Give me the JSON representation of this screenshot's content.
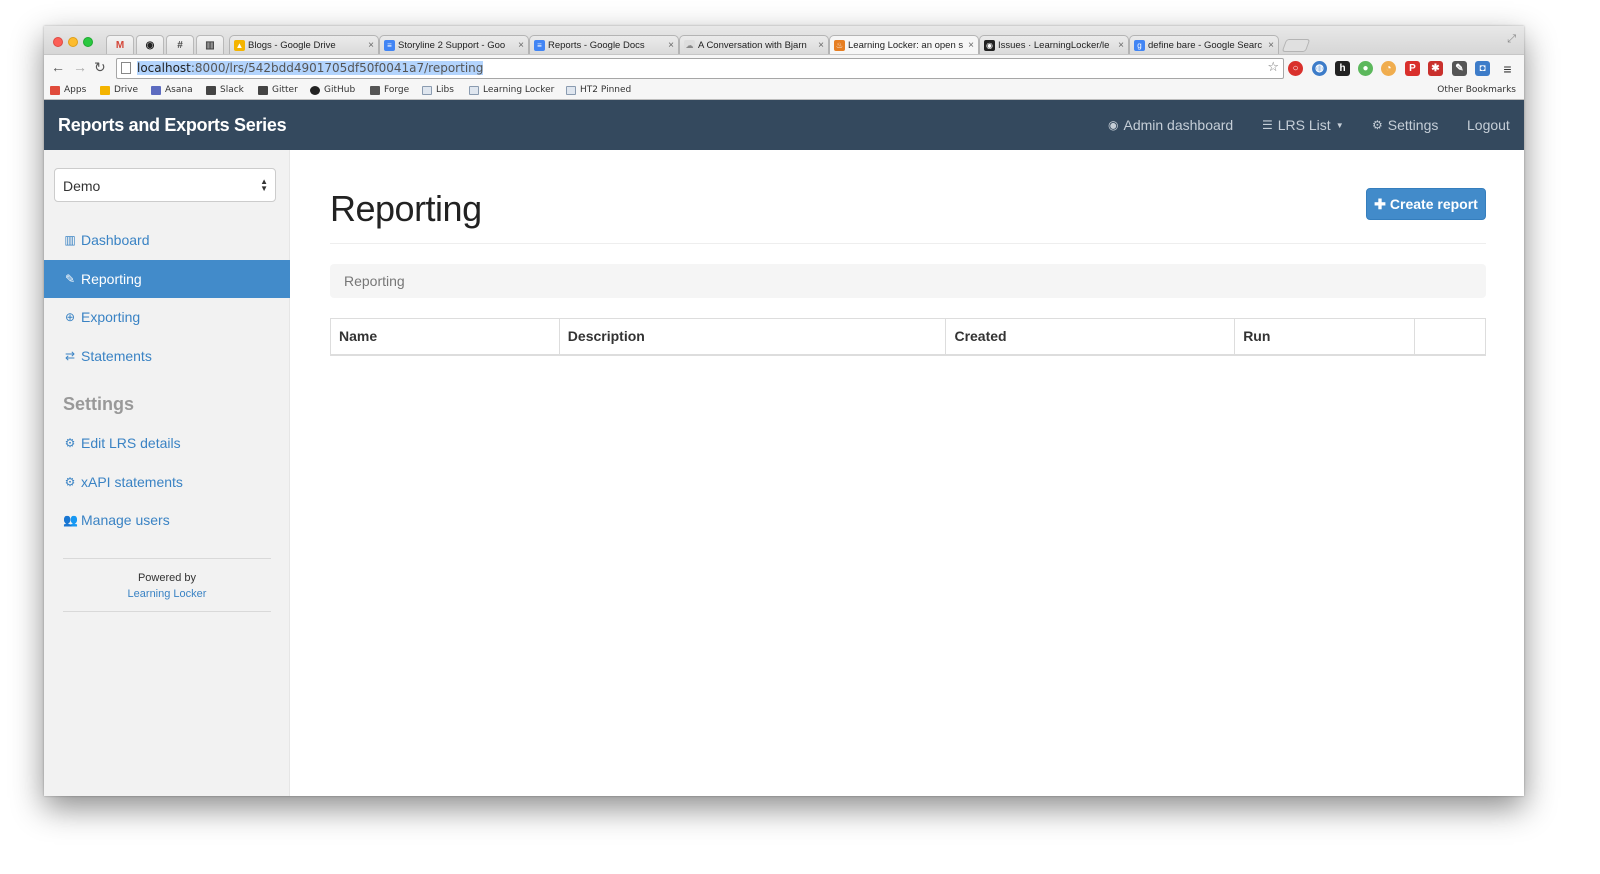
{
  "browser": {
    "pinned_tabs": [
      {
        "icon": "gmail-icon",
        "glyph": "M",
        "color": "#d44638"
      },
      {
        "icon": "github-icon",
        "glyph": "◉",
        "color": "#222222"
      },
      {
        "icon": "slack-icon",
        "glyph": "#",
        "color": "#444444"
      },
      {
        "icon": "gitter-icon",
        "glyph": "▥",
        "color": "#444444"
      }
    ],
    "tabs": [
      {
        "title": "Blogs - Google Drive",
        "icon": "drive-icon",
        "color": "#f4b400",
        "active": false
      },
      {
        "title": "Storyline 2 Support - Goo",
        "icon": "docs-icon",
        "color": "#4285f4",
        "active": false
      },
      {
        "title": "Reports - Google Docs",
        "icon": "docs-icon",
        "color": "#4285f4",
        "active": false
      },
      {
        "title": "A Conversation with Bjarn",
        "icon": "page-icon",
        "color": "#cccccc",
        "active": false
      },
      {
        "title": "Learning Locker: an open s",
        "icon": "flame-icon",
        "color": "#e67e22",
        "active": true
      },
      {
        "title": "Issues · LearningLocker/le",
        "icon": "github-icon",
        "color": "#222222",
        "active": false
      },
      {
        "title": "define bare - Google Searc",
        "icon": "google-icon",
        "color": "#4285f4",
        "active": false
      }
    ],
    "url": {
      "host": "localhost",
      "rest": ":8000/lrs/542bdd4901705df50f0041a7/reporting"
    },
    "bookmarks": [
      {
        "label": "Apps",
        "icon": "apps-icon",
        "color": "#e04b3b"
      },
      {
        "label": "Drive",
        "icon": "drive-icon",
        "color": "#f4b400"
      },
      {
        "label": "Asana",
        "icon": "asana-icon",
        "color": "#5c6bc0"
      },
      {
        "label": "Slack",
        "icon": "slack-icon",
        "color": "#444444"
      },
      {
        "label": "Gitter",
        "icon": "gitter-icon",
        "color": "#444444"
      },
      {
        "label": "GitHub",
        "icon": "github-icon",
        "color": "#222222"
      },
      {
        "label": "Forge",
        "icon": "forge-icon",
        "color": "#555555"
      },
      {
        "label": "Libs",
        "icon": "folder-icon",
        "color": "folder"
      },
      {
        "label": "Learning Locker",
        "icon": "folder-icon",
        "color": "folder"
      },
      {
        "label": "HT2 Pinned",
        "icon": "folder-icon",
        "color": "folder"
      }
    ],
    "other_bookmarks": "Other Bookmarks"
  },
  "navbar": {
    "brand": "Reports and Exports Series",
    "links": {
      "admin": "Admin dashboard",
      "lrs_list": "LRS List",
      "settings": "Settings",
      "logout": "Logout"
    }
  },
  "sidebar": {
    "lrs_select": "Demo",
    "items": {
      "dashboard": "Dashboard",
      "reporting": "Reporting",
      "exporting": "Exporting",
      "statements": "Statements"
    },
    "settings_heading": "Settings",
    "settings_items": {
      "edit_lrs": "Edit LRS details",
      "xapi": "xAPI statements",
      "manage_users": "Manage users"
    },
    "powered_by": "Powered by",
    "powered_link": "Learning Locker"
  },
  "main": {
    "title": "Reporting",
    "create_button": "Create report",
    "breadcrumb": "Reporting",
    "table_headers": {
      "name": "Name",
      "description": "Description",
      "created": "Created",
      "run": "Run",
      "actions": ""
    }
  },
  "colors": {
    "navbar": "#34495e",
    "accent": "#428bca",
    "link": "#3a83c4"
  }
}
